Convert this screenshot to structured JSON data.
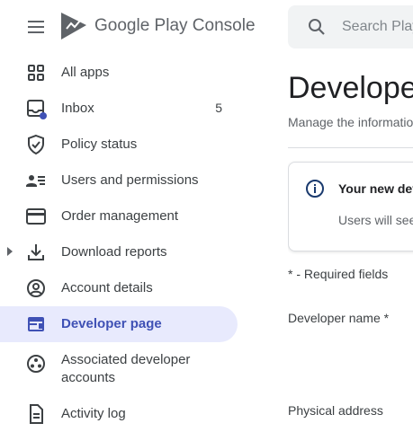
{
  "header": {
    "brand_google": "Google Play",
    "brand_console": "Console",
    "search_placeholder": "Search Play Console"
  },
  "sidebar": {
    "items": [
      {
        "label": "All apps",
        "icon": "grid-icon"
      },
      {
        "label": "Inbox",
        "icon": "inbox-icon",
        "badge": "5"
      },
      {
        "label": "Policy status",
        "icon": "shield-check-icon"
      },
      {
        "label": "Users and permissions",
        "icon": "users-list-icon"
      },
      {
        "label": "Order management",
        "icon": "credit-card-icon"
      },
      {
        "label": "Download reports",
        "icon": "download-icon"
      },
      {
        "label": "Account details",
        "icon": "account-circle-icon"
      },
      {
        "label": "Developer page",
        "icon": "web-page-icon",
        "active": true
      },
      {
        "label": "Associated developer accounts",
        "icon": "associated-accounts-icon"
      },
      {
        "label": "Activity log",
        "icon": "document-icon"
      }
    ]
  },
  "main": {
    "title": "Developer page",
    "subtitle": "Manage the information",
    "notice_title": "Your new developer page",
    "notice_body": "Users will see",
    "required_note": "* - Required fields",
    "fields": [
      {
        "label": "Developer name  *"
      },
      {
        "label": "Physical address"
      }
    ]
  },
  "colors": {
    "accent": "#3f51b5",
    "active_bg": "#e8eafd",
    "text": "#202124",
    "muted": "#5f6368",
    "badge_dot": "#3f51b5"
  }
}
